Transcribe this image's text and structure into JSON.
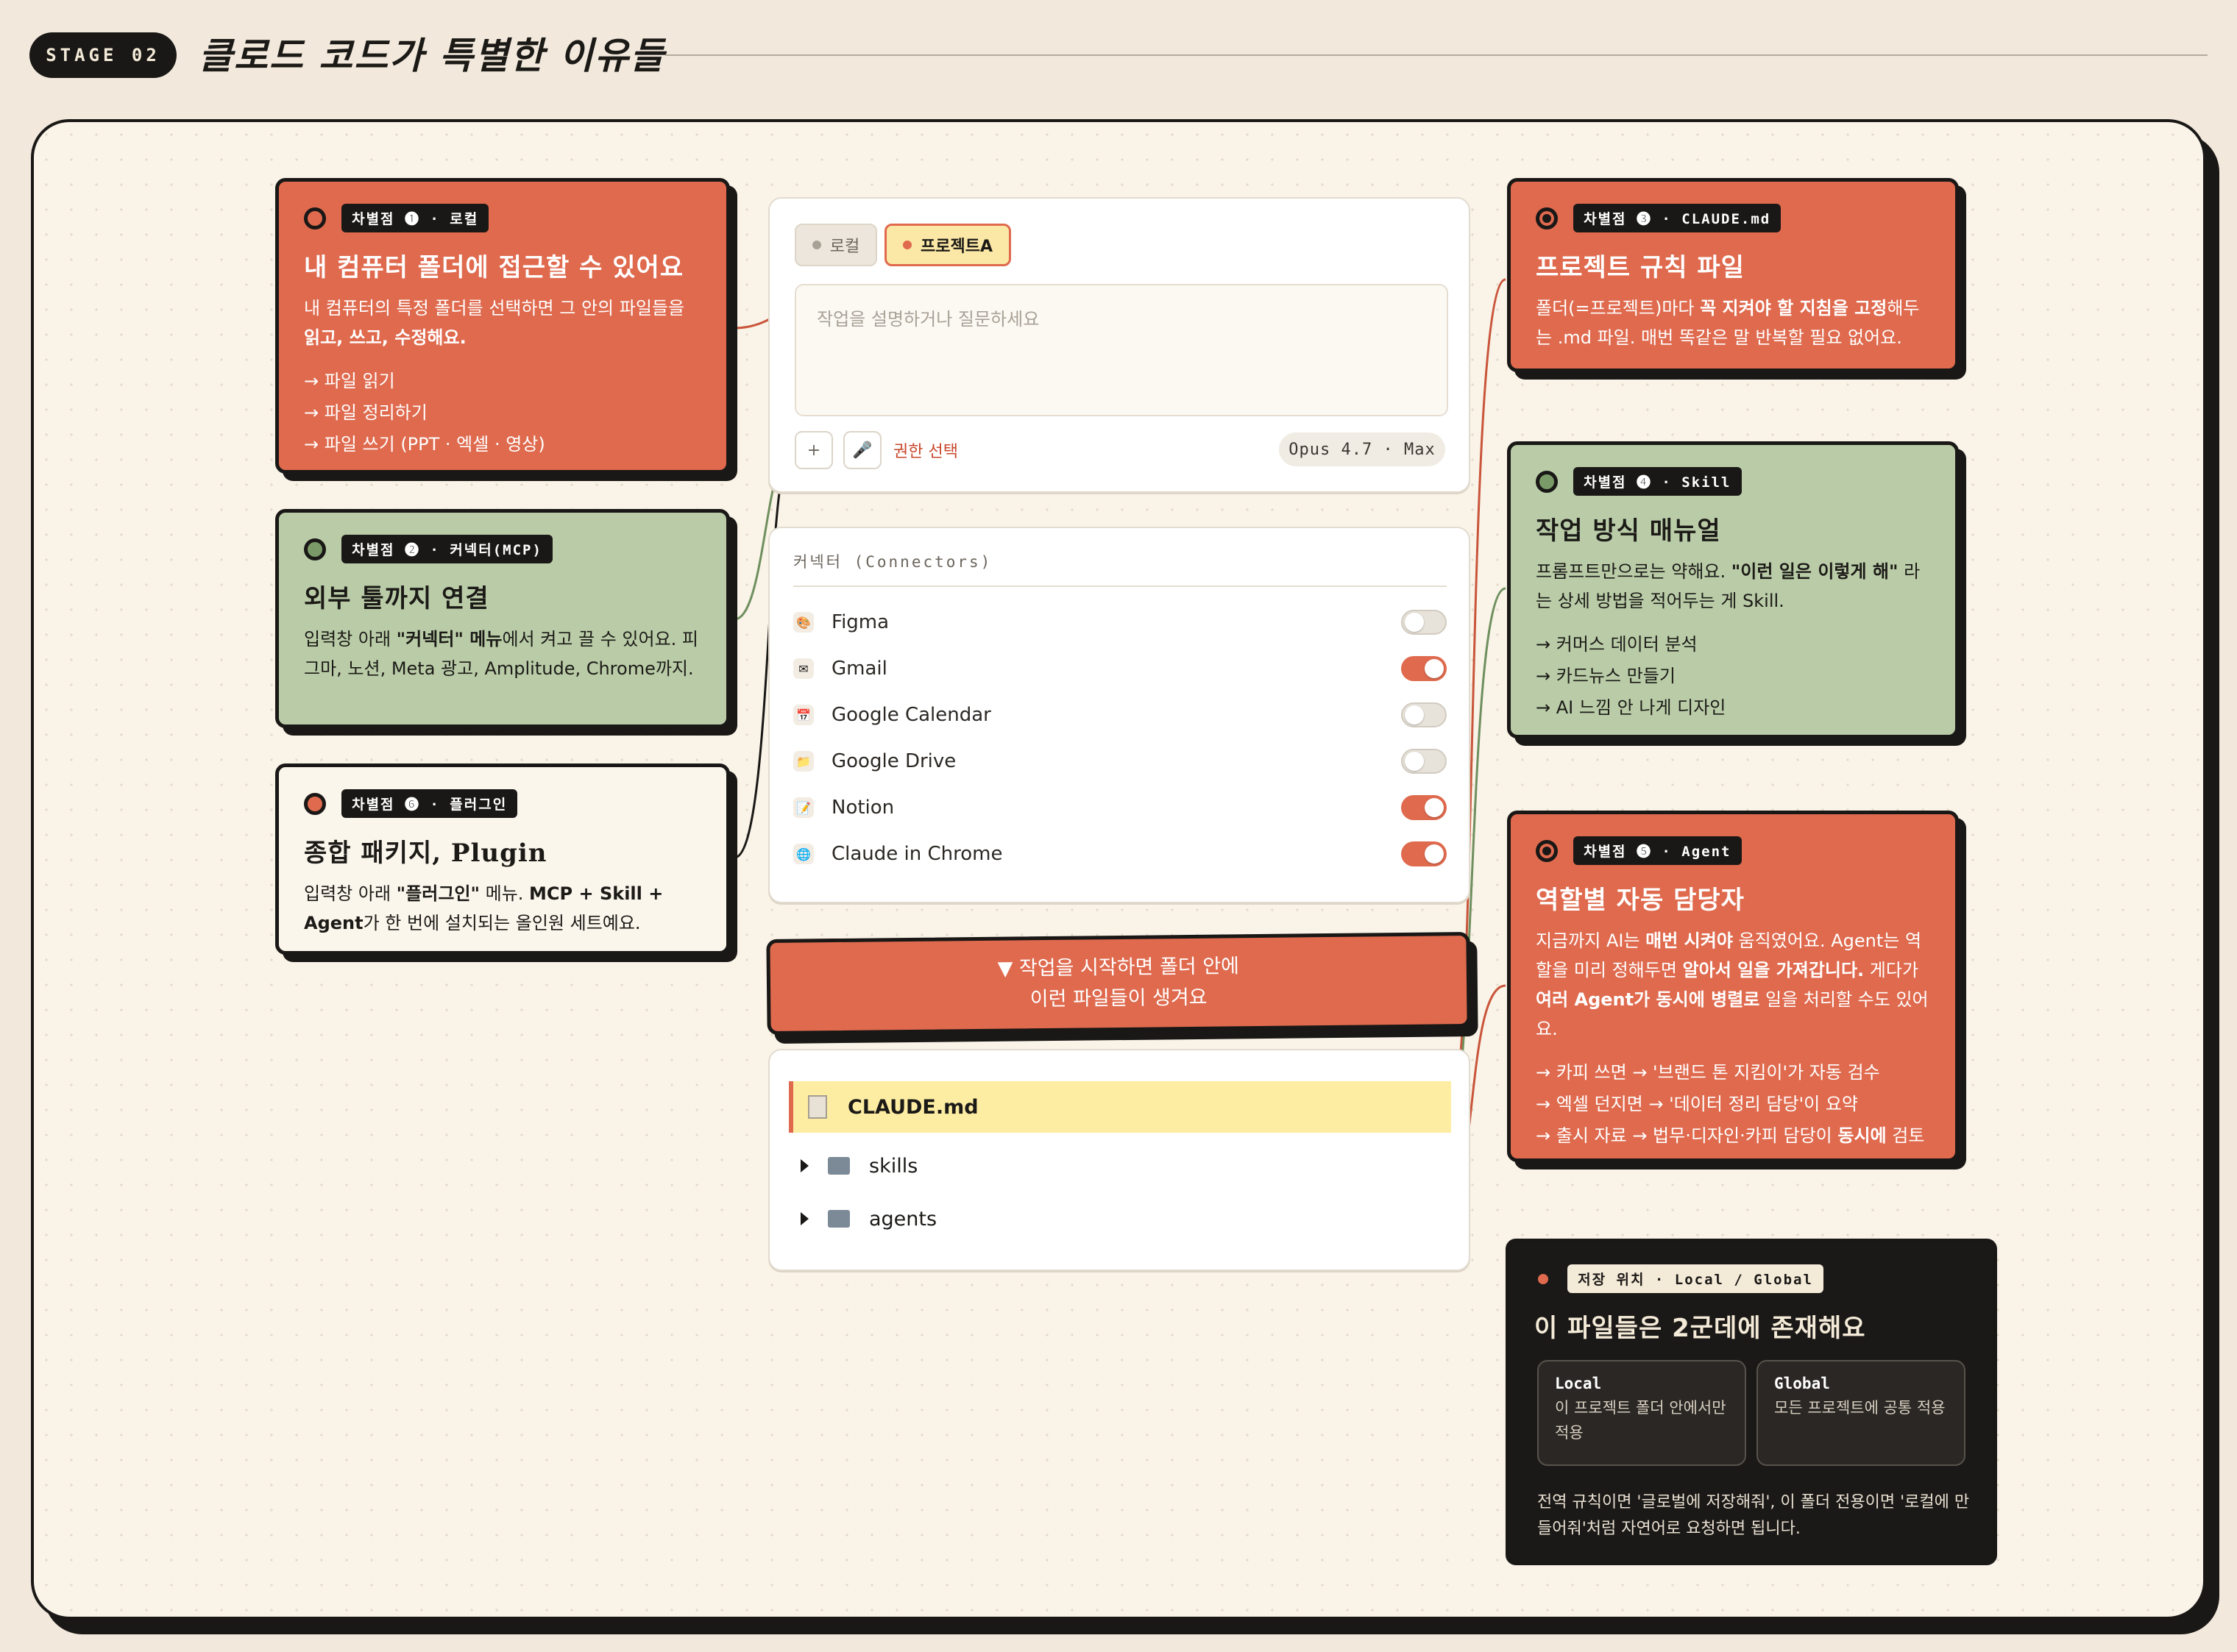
{
  "header": {
    "stage": "STAGE 02",
    "title": "클로드 코드가 특별한 이유들"
  },
  "cards": {
    "local": {
      "tag": "차별점 ❶ · 로컬",
      "title": "내 컴퓨터 폴더에 접근할 수 있어요",
      "desc": "내 컴퓨터의 특정 폴더를 선택하면 그 안의 파일들을",
      "desc_bold": "읽고, 쓰고, 수정해요.",
      "items": [
        "→ 파일 읽기",
        "→ 파일 정리하기",
        "→ 파일 쓰기 (PPT · 엑셀 · 영상)"
      ]
    },
    "mcp": {
      "tag": "차별점 ❷ · 커넥터(MCP)",
      "title": "외부 툴까지 연결",
      "desc_pre": "입력창 아래 ",
      "desc_bold": "\"커넥터\" 메뉴",
      "desc_post": "에서 켜고 끌 수 있어요. 피그마, 노션, Meta 광고, Amplitude, Chrome까지."
    },
    "plugin": {
      "tag": "차별점 ❻ · 플러그인",
      "title": "종합 패키지, Plugin",
      "desc_pre": "입력창 아래 ",
      "desc_bold1": "\"플러그인\"",
      "desc_mid": " 메뉴. ",
      "desc_bold2": "MCP + Skill + Agent",
      "desc_post": "가 한 번에 설치되는 올인원 세트예요."
    },
    "claude_md": {
      "tag": "차별점 ❸ · CLAUDE.md",
      "title": "프로젝트 규칙 파일",
      "desc_pre": "폴더(=프로젝트)마다 ",
      "desc_bold": "꼭 지켜야 할 지침을 고정",
      "desc_post": "해두는 .md 파일. 매번 똑같은 말 반복할 필요 없어요."
    },
    "skill": {
      "tag": "차별점 ❹ · Skill",
      "title": "작업 방식 매뉴얼",
      "desc_pre": "프롬프트만으로는 약해요. ",
      "desc_bold": "\"이런 일은 이렇게 해\"",
      "desc_post": " 라는 상세 방법을 적어두는 게 Skill.",
      "items": [
        "→ 커머스 데이터 분석",
        "→ 카드뉴스 만들기",
        "→ AI 느낌 안 나게 디자인"
      ]
    },
    "agent": {
      "tag": "차별점 ❺ · Agent",
      "title": "역할별 자동 담당자",
      "desc_1": "지금까지 AI는 ",
      "desc_b1": "매번 시켜야",
      "desc_2": " 움직였어요. Agent는 역할을 미리 정해두면 ",
      "desc_b2": "알아서 일을 가져갑니다.",
      "desc_3": " 게다가 ",
      "desc_b3": "여러 Agent가 동시에 병렬로",
      "desc_4": " 일을 처리할 수도 있어요.",
      "items": [
        "→ 카피 쓰면 → '브랜드 톤 지킴이'가 자동 검수",
        "→ 엑셀 던지면 → '데이터 정리 담당'이 요약",
        "→ 출시 자료 → 법무·디자인·카피 담당이 "
      ],
      "item3_bold": "동시에",
      "item3_post": " 검토"
    },
    "storage": {
      "tag": "저장 위치 · Local / Global",
      "title": "이 파일들은 2군데에 존재해요",
      "local_title": "Local",
      "local_desc": "이 프로젝트 폴더 안에서만 적용",
      "global_title": "Global",
      "global_desc": "모든 프로젝트에 공통 적용",
      "footer": "전역 규칙이면 '글로벌에 저장해줘', 이 폴더 전용이면 '로컬에 만들어줘'처럼 자연어로 요청하면 됩니다."
    }
  },
  "chat": {
    "chip_local": "로컬",
    "chip_project": "프로젝트A",
    "placeholder": "작업을 설명하거나 질문하세요",
    "add_icon": "+",
    "mic_icon": "🎤",
    "permission": "권한 선택",
    "model": "Opus 4.7 · Max"
  },
  "connectors": {
    "title": "커넥터 (Connectors)",
    "items": [
      {
        "name": "Figma",
        "icon": "🎨",
        "on": false
      },
      {
        "name": "Gmail",
        "icon": "✉",
        "on": true
      },
      {
        "name": "Google Calendar",
        "icon": "📅",
        "on": false
      },
      {
        "name": "Google Drive",
        "icon": "📁",
        "on": false
      },
      {
        "name": "Notion",
        "icon": "📝",
        "on": true
      },
      {
        "name": "Claude in Chrome",
        "icon": "🌐",
        "on": true
      }
    ]
  },
  "banner": {
    "line1": "▼ 작업을 시작하면 폴더 안에",
    "line2": "이런 파일들이 생겨요"
  },
  "files": {
    "claude_md": "CLAUDE.md",
    "skills": "skills",
    "agents": "agents"
  },
  "colors": {
    "accent": "#df6a4e",
    "green": "#b9cca7",
    "dark": "#1a1816",
    "cream": "#f9f3e8",
    "highlight": "#fdeda3"
  }
}
